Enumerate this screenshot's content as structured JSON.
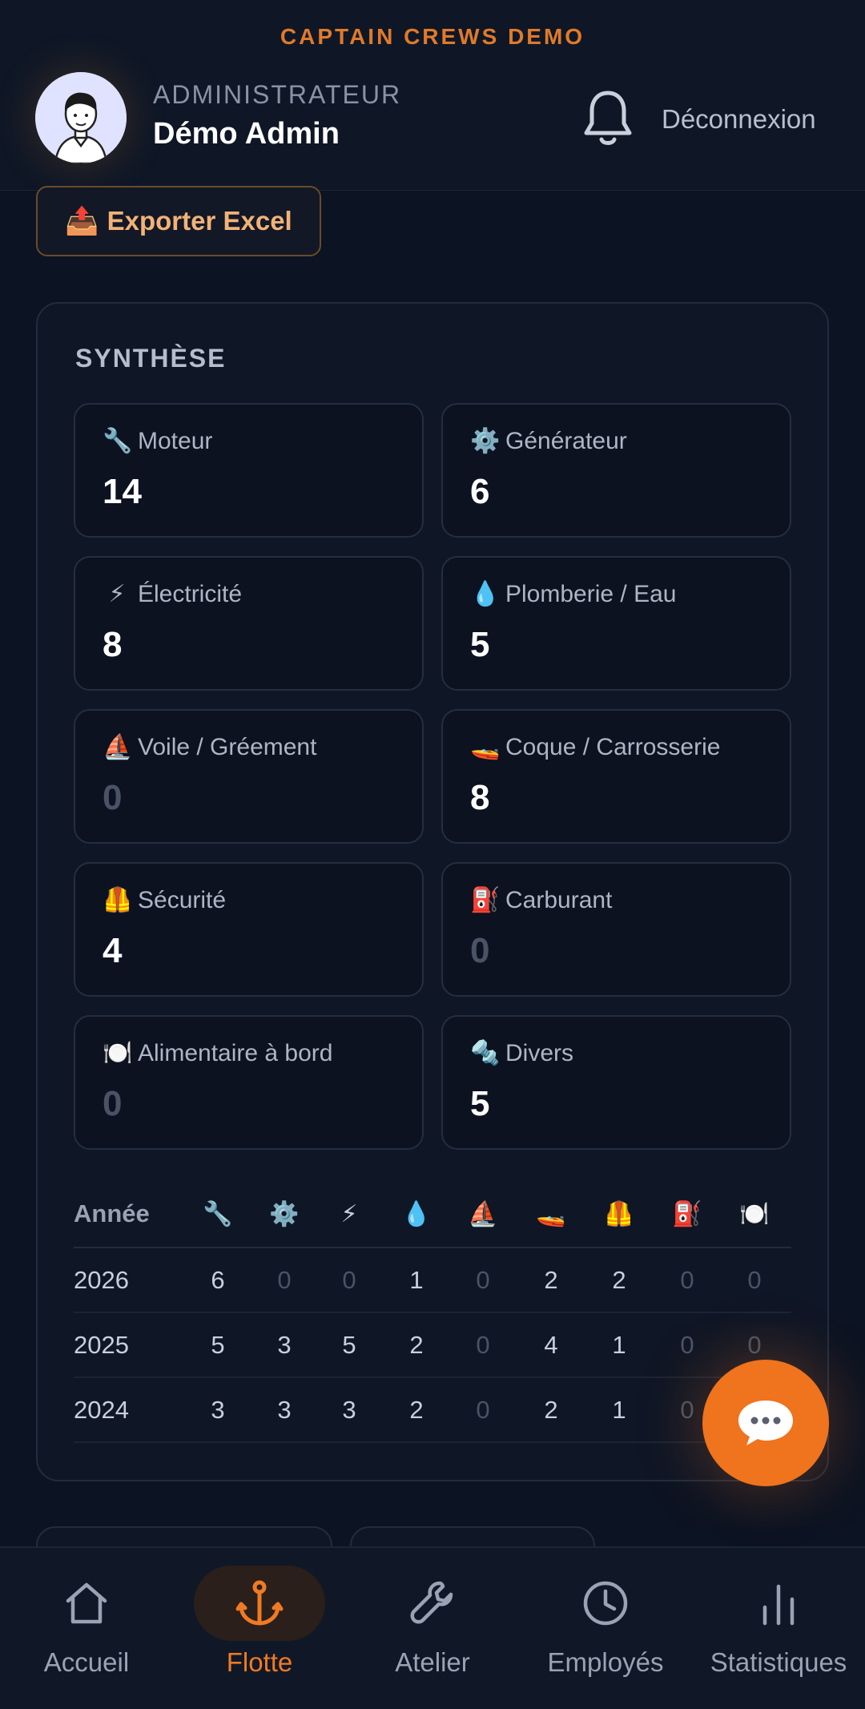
{
  "header": {
    "brand": "CAPTAIN CREWS DEMO",
    "role": "ADMINISTRATEUR",
    "user_name": "Démo Admin",
    "logout_label": "Déconnexion"
  },
  "export": {
    "icon": "📤",
    "label": "Exporter Excel"
  },
  "synthese": {
    "title": "SYNTHÈSE",
    "tiles": [
      {
        "icon": "🔧",
        "label": "Moteur",
        "value": "14"
      },
      {
        "icon": "⚙️",
        "label": "Générateur",
        "value": "6"
      },
      {
        "icon": "⚡",
        "label": "Électricité",
        "value": "8"
      },
      {
        "icon": "💧",
        "label": "Plomberie / Eau",
        "value": "5"
      },
      {
        "icon": "⛵",
        "label": "Voile / Gréement",
        "value": "0"
      },
      {
        "icon": "🚤",
        "label": "Coque / Carrosserie",
        "value": "8"
      },
      {
        "icon": "🦺",
        "label": "Sécurité",
        "value": "4"
      },
      {
        "icon": "⛽",
        "label": "Carburant",
        "value": "0"
      },
      {
        "icon": "🍽️",
        "label": "Alimentaire à bord",
        "value": "0"
      },
      {
        "icon": "🔩",
        "label": "Divers",
        "value": "5"
      }
    ]
  },
  "year_table": {
    "year_header": "Année",
    "column_icons": [
      "🔧",
      "⚙️",
      "⚡",
      "💧",
      "⛵",
      "🚤",
      "🦺",
      "⛽",
      "🍽️"
    ],
    "rows": [
      {
        "year": "2026",
        "values": [
          "6",
          "0",
          "0",
          "1",
          "0",
          "2",
          "2",
          "0",
          "0"
        ]
      },
      {
        "year": "2025",
        "values": [
          "5",
          "3",
          "5",
          "2",
          "0",
          "4",
          "1",
          "0",
          "0"
        ]
      },
      {
        "year": "2024",
        "values": [
          "3",
          "3",
          "3",
          "2",
          "0",
          "2",
          "1",
          "0",
          "0"
        ]
      }
    ]
  },
  "nav": {
    "items": [
      {
        "label": "Accueil",
        "icon": "home-icon",
        "active": false
      },
      {
        "label": "Flotte",
        "icon": "anchor-icon",
        "active": true
      },
      {
        "label": "Atelier",
        "icon": "wrench-icon",
        "active": false
      },
      {
        "label": "Employés",
        "icon": "clock-icon",
        "active": false
      },
      {
        "label": "Statistiques",
        "icon": "bar-chart-icon",
        "active": false
      }
    ]
  },
  "colors": {
    "accent": "#f07a24",
    "background": "#0c1322",
    "fab": "#f0731d"
  }
}
